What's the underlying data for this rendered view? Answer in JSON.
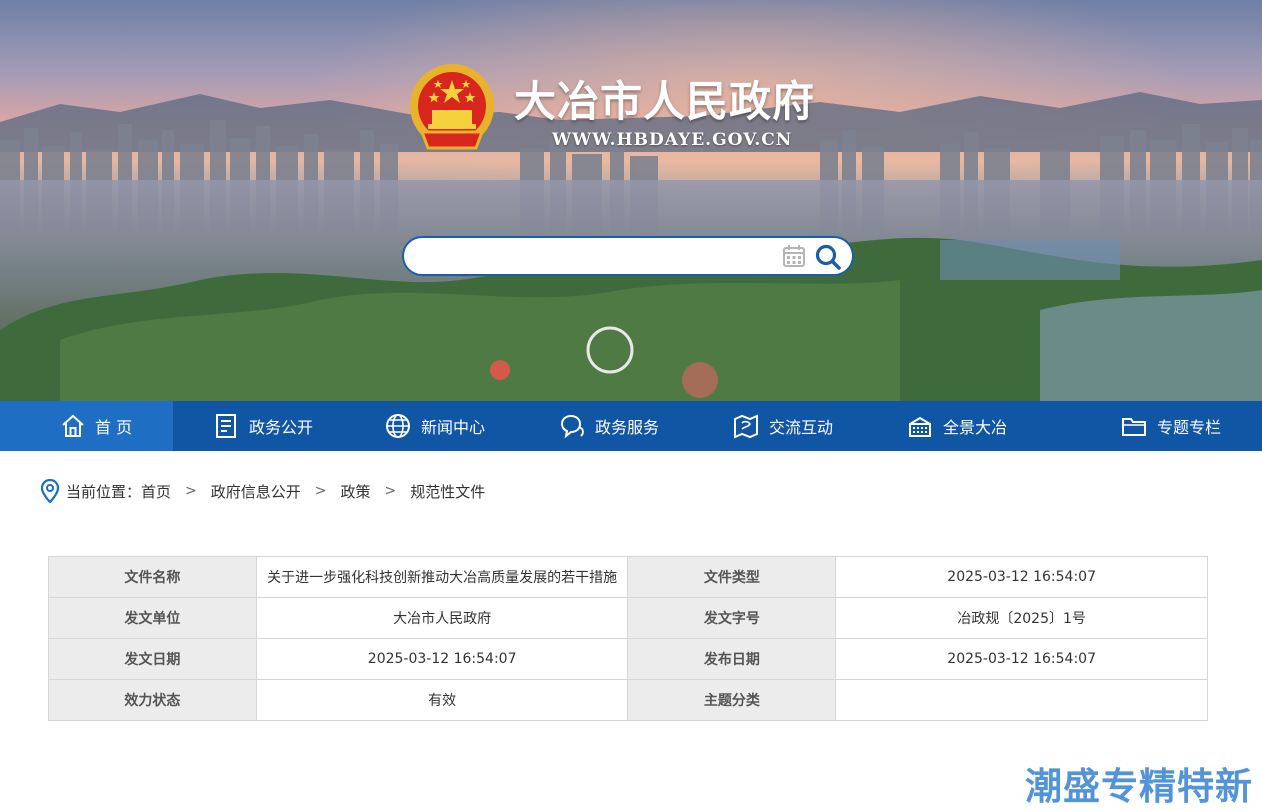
{
  "header": {
    "title": "大冶市人民政府",
    "url": "WWW.HBDAYE.GOV.CN",
    "emblem_icon": "national-emblem-icon"
  },
  "search": {
    "placeholder": "",
    "value": ""
  },
  "nav": {
    "items": [
      {
        "label": "首 页",
        "icon": "home-icon",
        "active": true
      },
      {
        "label": "政务公开",
        "icon": "document-icon",
        "active": false
      },
      {
        "label": "新闻中心",
        "icon": "globe-icon",
        "active": false
      },
      {
        "label": "政务服务",
        "icon": "chat-icon",
        "active": false
      },
      {
        "label": "交流互动",
        "icon": "map-icon",
        "active": false
      },
      {
        "label": "全景大冶",
        "icon": "panorama-icon",
        "active": false
      },
      {
        "label": "专题专栏",
        "icon": "folder-icon",
        "active": false
      }
    ]
  },
  "breadcrumb": {
    "prefix": "当前位置：",
    "items": [
      "首页",
      "政府信息公开",
      "政策",
      "规范性文件"
    ],
    "separator": ">"
  },
  "info": {
    "rows": [
      {
        "k1": "文件名称",
        "v1": "关于进一步强化科技创新推动大冶高质量发展的若干措施",
        "k2": "文件类型",
        "v2": "2025-03-12 16:54:07"
      },
      {
        "k1": "发文单位",
        "v1": "大冶市人民政府",
        "k2": "发文字号",
        "v2": "冶政规〔2025〕1号"
      },
      {
        "k1": "发文日期",
        "v1": "2025-03-12 16:54:07",
        "k2": "发布日期",
        "v2": "2025-03-12 16:54:07"
      },
      {
        "k1": "效力状态",
        "v1": "有效",
        "k2": "主题分类",
        "v2": ""
      }
    ]
  },
  "watermark": "潮盛专精特新",
  "colors": {
    "nav_bg": "#1056a5",
    "nav_active": "#1e6fc4",
    "search_border": "#1a5ea8",
    "table_header_bg": "#ececec",
    "watermark": "#4a8fd8"
  }
}
